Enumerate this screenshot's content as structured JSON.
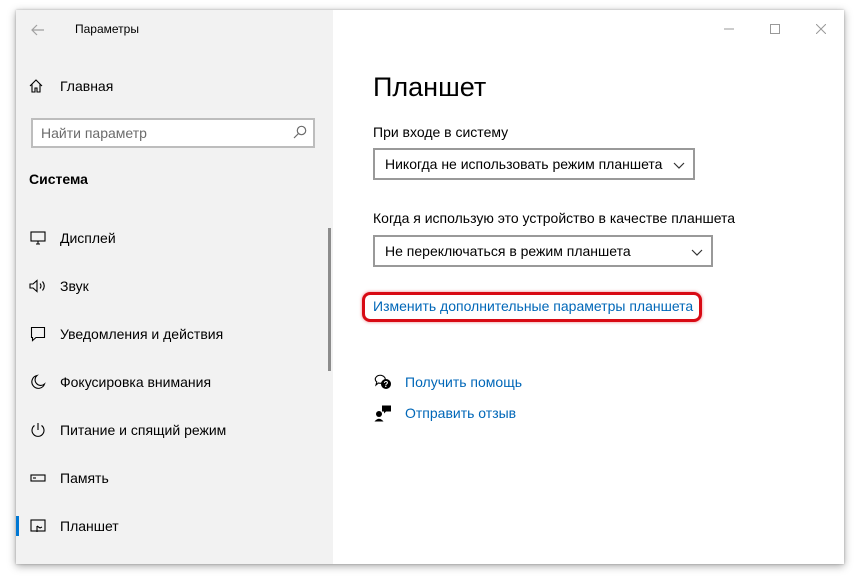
{
  "window": {
    "title": "Параметры"
  },
  "sidebar": {
    "home_label": "Главная",
    "search_placeholder": "Найти параметр",
    "section_title": "Система",
    "items": [
      {
        "label": "Дисплей",
        "icon": "display-icon"
      },
      {
        "label": "Звук",
        "icon": "speaker-icon"
      },
      {
        "label": "Уведомления и действия",
        "icon": "notification-icon"
      },
      {
        "label": "Фокусировка внимания",
        "icon": "moon-icon"
      },
      {
        "label": "Питание и спящий режим",
        "icon": "power-icon"
      },
      {
        "label": "Память",
        "icon": "storage-icon"
      },
      {
        "label": "Планшет",
        "icon": "tablet-icon",
        "active": true
      }
    ]
  },
  "main": {
    "title": "Планшет",
    "signin_label": "При входе в систему",
    "signin_value": "Никогда не использовать режим планшета",
    "tablet_label": "Когда я использую это устройство в качестве планшета",
    "tablet_value": "Не переключаться в режим планшета",
    "advanced_link": "Изменить дополнительные параметры планшета",
    "help_link": "Получить помощь",
    "feedback_link": "Отправить отзыв"
  },
  "colors": {
    "accent": "#0078d4",
    "link": "#0067b8",
    "highlight": "#d80a14",
    "sidebar_bg": "#f2f2f2"
  }
}
